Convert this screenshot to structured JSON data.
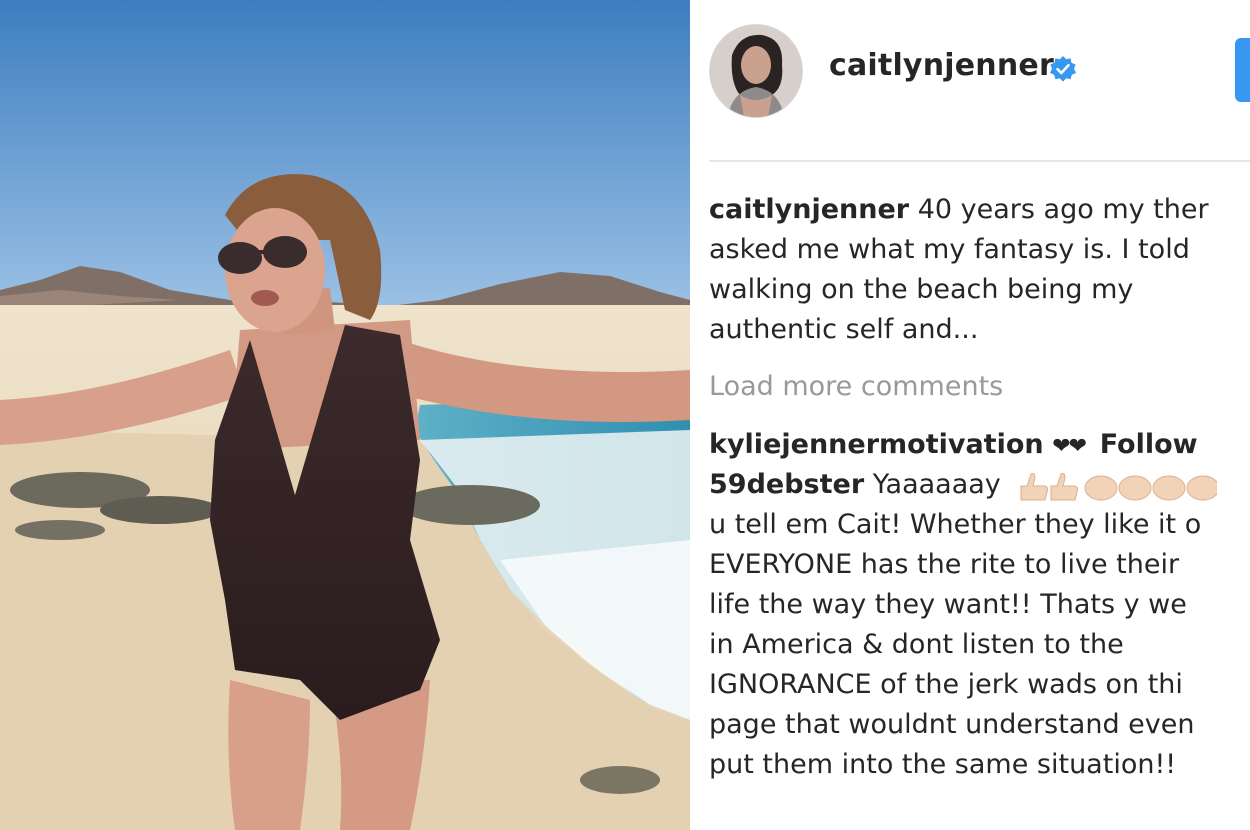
{
  "post": {
    "author": "caitlynjenner",
    "verified_icon": "verified-badge-icon",
    "follow_button_color": "#3897f0",
    "caption_lines": [
      "40 years ago my ther",
      "asked me what my fantasy is. I told",
      "walking on the beach being my",
      "authentic self and..."
    ],
    "load_more_label": "Load more comments"
  },
  "comments": [
    {
      "username": "kyliejennermotivation",
      "hearts": "❤❤",
      "follow_label": "Follow"
    },
    {
      "username": "59debster",
      "first_text": "Yaaaaaay",
      "emoji_icon": "thumbs-up-and-clap-emoji-icons",
      "lines": [
        "u tell em Cait! Whether they like it o",
        "EVERYONE has the rite to live their",
        "life the way they want!! Thats y we",
        "in America & dont listen to the",
        "IGNORANCE of the jerk wads on thi",
        "page that wouldnt understand even",
        "put them into the same situation!!"
      ]
    }
  ],
  "colors": {
    "text": "#262626",
    "muted": "#999999",
    "divider": "#e6e6e6",
    "verified": "#3897f0"
  }
}
